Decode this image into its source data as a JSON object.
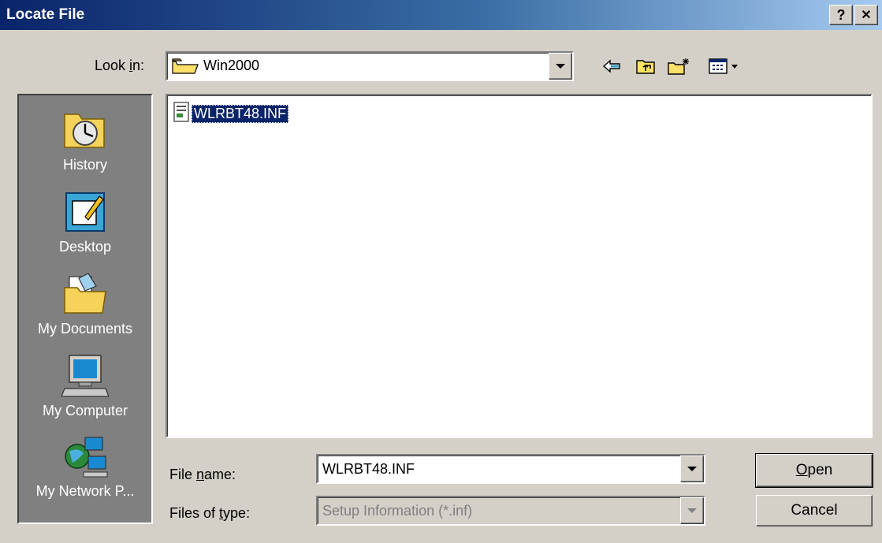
{
  "window": {
    "title": "Locate File",
    "help_label": "?",
    "close_label": "✕"
  },
  "look_in": {
    "label_pre": "Look ",
    "label_key": "i",
    "label_post": "n:",
    "value": "Win2000"
  },
  "toolbar": {
    "icons": [
      "back-icon",
      "up-folder-icon",
      "new-folder-icon",
      "view-menu-icon"
    ]
  },
  "places": [
    {
      "label": "History",
      "icon": "history-icon"
    },
    {
      "label": "Desktop",
      "icon": "desktop-icon"
    },
    {
      "label": "My Documents",
      "icon": "my-documents-icon"
    },
    {
      "label": "My Computer",
      "icon": "my-computer-icon"
    },
    {
      "label": "My Network P...",
      "icon": "my-network-places-icon"
    }
  ],
  "files": [
    {
      "name": "WLRBT48.INF",
      "icon": "setup-file-icon",
      "selected": true
    }
  ],
  "file_name": {
    "label_pre": "File ",
    "label_key": "n",
    "label_post": "ame:",
    "value": "WLRBT48.INF"
  },
  "file_type": {
    "label_pre": "Files of ",
    "label_key": "t",
    "label_post": "ype:",
    "value": "Setup Information (*.inf)",
    "disabled": true
  },
  "buttons": {
    "open_key": "O",
    "open_rest": "pen",
    "cancel": "Cancel"
  },
  "colors": {
    "title_start": "#0a246a",
    "title_end": "#a6caf0",
    "selection": "#0a246a",
    "face": "#d4d0c8"
  }
}
